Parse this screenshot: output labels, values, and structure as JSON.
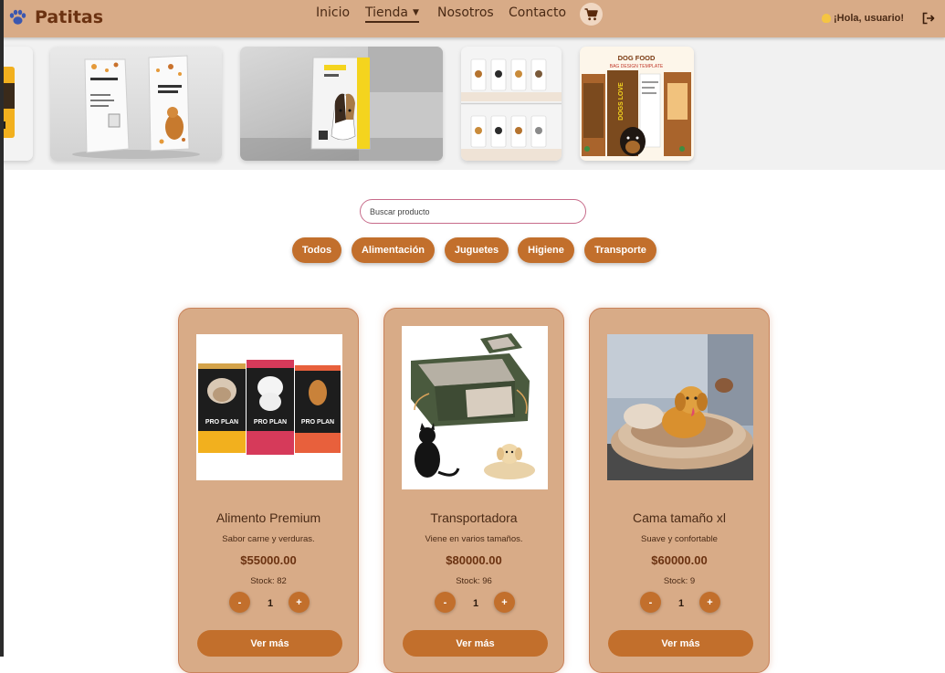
{
  "brand": {
    "title": "Patitas",
    "logo_icon": "paw-icon"
  },
  "nav": {
    "items": [
      {
        "label": "Inicio"
      },
      {
        "label": "Tienda",
        "active": true,
        "has_dropdown": true
      },
      {
        "label": "Nosotros"
      },
      {
        "label": "Contacto"
      }
    ],
    "cart_icon": "cart-icon"
  },
  "user": {
    "greeting": "¡Hola, usuario!",
    "logout_icon": "logout-icon"
  },
  "carousel": {
    "slides": [
      {
        "name": "carousel-slide-partial"
      },
      {
        "name": "carousel-slide-dog-bites-bags"
      },
      {
        "name": "carousel-slide-dog-food-bag"
      },
      {
        "name": "carousel-slide-bag-grid"
      },
      {
        "name": "carousel-slide-dogs-love-template",
        "header_text": "DOG FOOD",
        "sub_text": "BAG DESIGN TEMPLATE",
        "bag_text": "DOGS LOVE"
      }
    ]
  },
  "search": {
    "placeholder": "Buscar producto",
    "value": ""
  },
  "filters": [
    "Todos",
    "Alimentación",
    "Juguetes",
    "Higiene",
    "Transporte"
  ],
  "products": [
    {
      "name": "Alimento Premium",
      "description": "Sabor carne y verduras.",
      "price": "$55000.00",
      "stock": "Stock: 82",
      "quantity": "1",
      "minus": "-",
      "plus": "+",
      "button": "Ver más",
      "image_brand": "PRO PLAN"
    },
    {
      "name": "Transportadora",
      "description": "Viene en varios tamaños.",
      "price": "$80000.00",
      "stock": "Stock: 96",
      "quantity": "1",
      "minus": "-",
      "plus": "+",
      "button": "Ver más"
    },
    {
      "name": "Cama tamaño xl",
      "description": "Suave y confortable",
      "price": "$60000.00",
      "stock": "Stock: 9",
      "quantity": "1",
      "minus": "-",
      "plus": "+",
      "button": "Ver más"
    }
  ],
  "colors": {
    "header_bg": "#d8ab87",
    "card_bg": "#d8ab87",
    "accent": "#c26f2c",
    "brand_text": "#6b3211",
    "search_border": "#c76b8a"
  }
}
